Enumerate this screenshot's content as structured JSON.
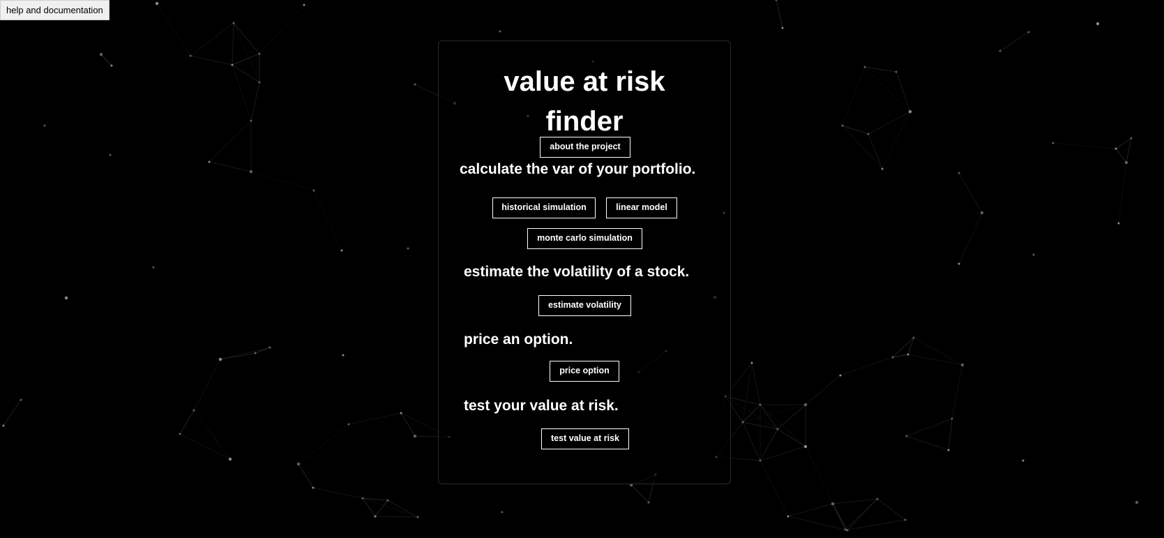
{
  "colors": {
    "background": "#000000",
    "text": "#ffffff",
    "network_lines": "#3a3a3a",
    "network_nodes": "#9a9a9a",
    "help_button_bg": "#f0f0f0"
  },
  "help_button": {
    "label": "help and documentation"
  },
  "panel": {
    "title_line1": "value at risk",
    "title_line2": "finder",
    "about_button": "about the project",
    "sections": {
      "var": {
        "heading": "calculate the var of your portfolio.",
        "buttons": {
          "historical": "historical simulation",
          "linear": "linear model",
          "monte_carlo": "monte carlo simulation"
        }
      },
      "volatility": {
        "heading": "estimate the volatility of a stock.",
        "button": "estimate volatility"
      },
      "option": {
        "heading": "price an option.",
        "button": "price option"
      },
      "test": {
        "heading": "test your value at risk.",
        "button": "test value at risk"
      }
    }
  }
}
